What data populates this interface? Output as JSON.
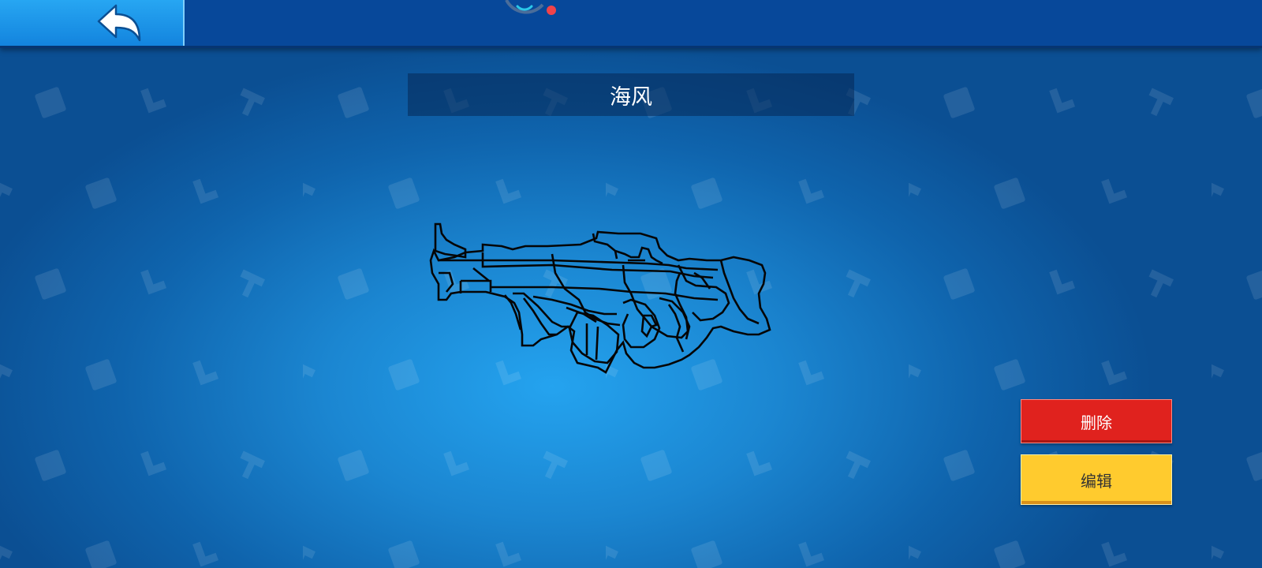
{
  "header": {
    "back_icon": "back-arrow-icon",
    "loading_icon": "loading-ring-icon"
  },
  "item": {
    "name": "海风",
    "preview_icon": "pixel-gun-outline-icon"
  },
  "actions": {
    "delete_label": "删除",
    "edit_label": "编辑"
  },
  "colors": {
    "topbar": "#07489a",
    "back_button": "#1e96e8",
    "delete_button": "#e0221e",
    "edit_button": "#ffcb2e",
    "background_center": "#24a3ef"
  }
}
